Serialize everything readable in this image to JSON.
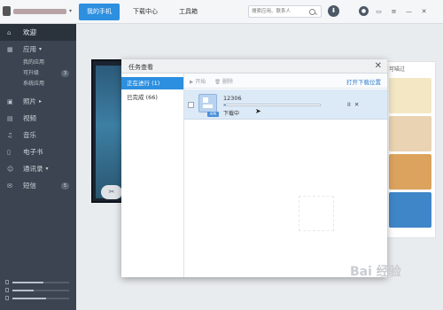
{
  "header": {
    "tabs": [
      {
        "label": "我的手机",
        "active": true
      },
      {
        "label": "下载中心",
        "active": false
      },
      {
        "label": "工具箱",
        "active": false
      }
    ],
    "search_placeholder": "搜索应用、联系人",
    "accent_color": "#2d8fe0"
  },
  "sidebar": {
    "items": [
      {
        "label": "欢迎",
        "icon": "home-icon",
        "active": true
      },
      {
        "label": "应用",
        "icon": "apps-grid-icon",
        "caret": "▾"
      },
      {
        "label": "照片",
        "icon": "photo-icon",
        "caret": "▸"
      },
      {
        "label": "视频",
        "icon": "video-icon"
      },
      {
        "label": "音乐",
        "icon": "music-icon"
      },
      {
        "label": "电子书",
        "icon": "book-icon"
      },
      {
        "label": "通讯录",
        "icon": "contacts-icon",
        "caret": "▾"
      },
      {
        "label": "短信",
        "icon": "sms-icon",
        "count": "5"
      }
    ],
    "app_subitems": [
      {
        "label": "我的应用"
      },
      {
        "label": "可升级",
        "count": "3"
      },
      {
        "label": "系统应用"
      }
    ],
    "storage_levels": [
      0.55,
      0.38,
      0.6
    ]
  },
  "background": {
    "ad_header": "可喵过"
  },
  "dialog": {
    "title": "任务查看",
    "close": "✕",
    "categories": [
      {
        "label": "正在进行 (1)",
        "active": true
      },
      {
        "label": "已完成 (66)",
        "active": false
      }
    ],
    "toolbar": {
      "start": "开始",
      "delete": "删除",
      "open_location": "打开下载位置"
    },
    "task": {
      "name": "12306",
      "badge": "APK",
      "status": "下载中",
      "progress": 0.02,
      "pause": "II",
      "cancel": "✕"
    }
  },
  "watermark": "Bai 经验"
}
